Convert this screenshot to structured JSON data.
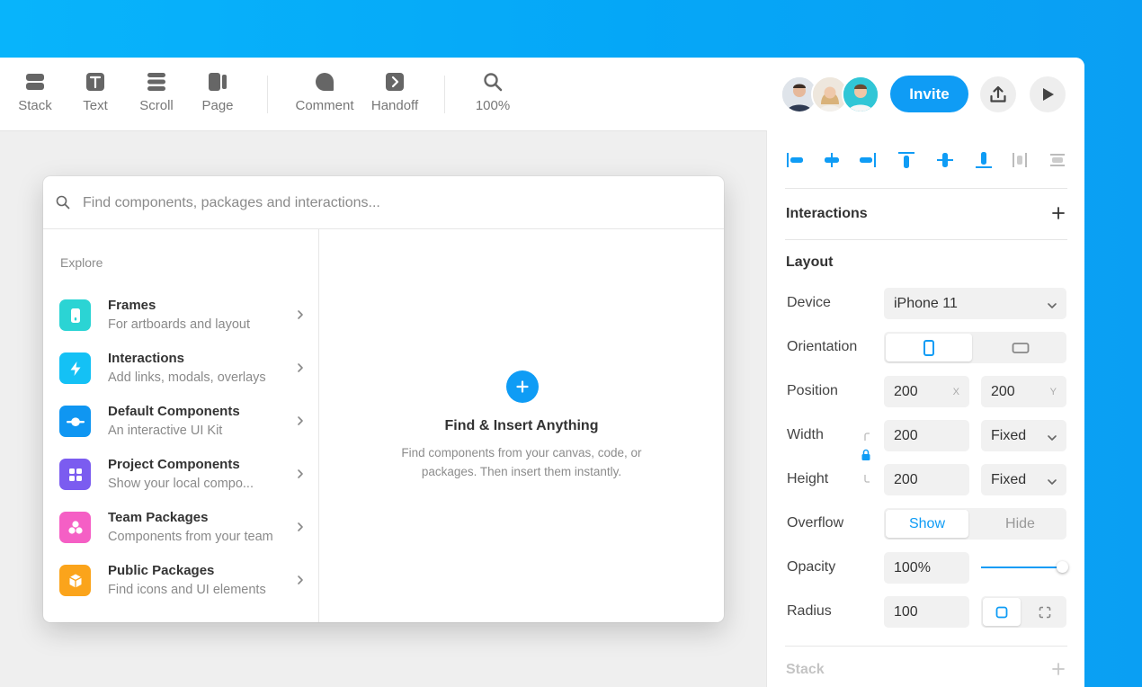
{
  "toolbar": {
    "tools": [
      {
        "label": "Stack",
        "icon": "stack-icon"
      },
      {
        "label": "Text",
        "icon": "text-icon"
      },
      {
        "label": "Scroll",
        "icon": "scroll-icon"
      },
      {
        "label": "Page",
        "icon": "page-icon"
      },
      {
        "label": "Comment",
        "icon": "comment-icon"
      },
      {
        "label": "Handoff",
        "icon": "handoff-icon"
      },
      {
        "label": "100%",
        "icon": "zoom-icon"
      }
    ],
    "invite_label": "Invite"
  },
  "insert_panel": {
    "search_placeholder": "Find components, packages and interactions...",
    "explore_heading": "Explore",
    "items": [
      {
        "title": "Frames",
        "desc": "For artboards and layout",
        "color": "#2bd4d4",
        "icon": "frames-icon"
      },
      {
        "title": "Interactions",
        "desc": "Add links, modals, overlays",
        "color": "#14c1f5",
        "icon": "lightning-icon"
      },
      {
        "title": "Default Components",
        "desc": "An interactive UI Kit",
        "color": "#0f96f2",
        "icon": "toggle-icon"
      },
      {
        "title": "Project Components",
        "desc": "Show your local compo...",
        "color": "#7b5cf0",
        "icon": "grid-icon"
      },
      {
        "title": "Team Packages",
        "desc": "Components from your team",
        "color": "#f55fc5",
        "icon": "team-icon"
      },
      {
        "title": "Public Packages",
        "desc": "Find icons and UI elements",
        "color": "#fba41b",
        "icon": "cube-icon"
      }
    ],
    "empty_title": "Find & Insert Anything",
    "empty_desc": "Find components from your canvas, code, or packages. Then insert them instantly."
  },
  "properties": {
    "interactions_title": "Interactions",
    "layout_title": "Layout",
    "device_label": "Device",
    "device_value": "iPhone 11",
    "orientation_label": "Orientation",
    "position_label": "Position",
    "position_x": "200",
    "position_y": "200",
    "axis_x": "X",
    "axis_y": "Y",
    "width_label": "Width",
    "width_value": "200",
    "width_mode": "Fixed",
    "height_label": "Height",
    "height_value": "200",
    "height_mode": "Fixed",
    "overflow_label": "Overflow",
    "overflow_show": "Show",
    "overflow_hide": "Hide",
    "opacity_label": "Opacity",
    "opacity_value": "100%",
    "opacity_slider_fraction": 1.0,
    "radius_label": "Radius",
    "radius_value": "100",
    "stack_title": "Stack"
  },
  "colors": {
    "accent": "#0f9cf5",
    "background": "#08b4fb"
  }
}
